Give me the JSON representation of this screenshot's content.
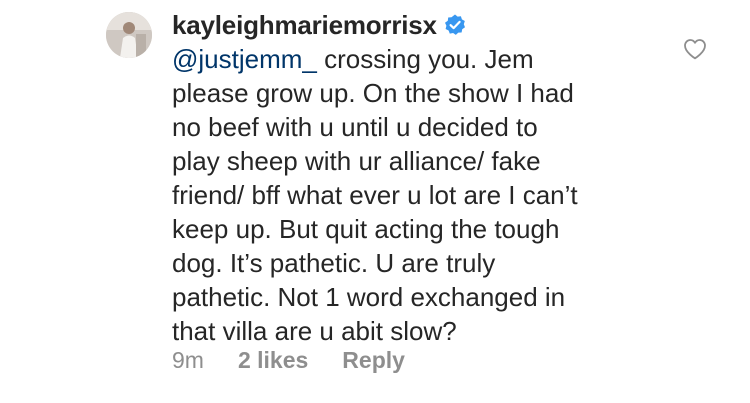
{
  "comment": {
    "username": "kayleighmariemorrisx",
    "mention": "@justjemm_",
    "text_lines": [
      " crossing you. Jem",
      "please grow up. On the show I had",
      "no beef with u until u decided to",
      "play sheep with ur alliance/ fake",
      "friend/ bff what ever u lot are I can’t",
      "keep up. But quit acting the tough",
      "dog. It’s pathetic. U are truly",
      "pathetic. Not 1 word exchanged in",
      "that villa are u abit slow?"
    ],
    "time": "9m",
    "likes": "2 likes",
    "reply_label": "Reply",
    "icons": {
      "verified": "verified-badge-icon",
      "like": "heart-outline-icon"
    },
    "colors": {
      "text": "#262626",
      "mention": "#003569",
      "meta": "#8e8e8e",
      "verified": "#3897f0"
    }
  }
}
